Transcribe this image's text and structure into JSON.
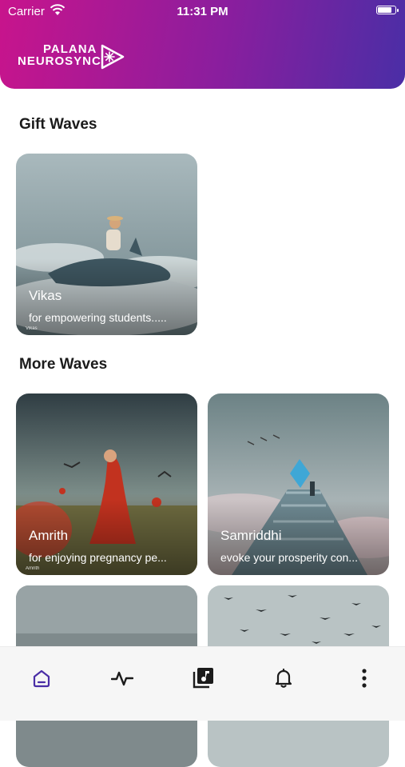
{
  "status_bar": {
    "carrier": "Carrier",
    "time": "11:31 PM",
    "battery_level": 0.9
  },
  "brand": {
    "line1": "PALANA",
    "line2": "NEUROSYNC"
  },
  "sections": {
    "gift_title": "Gift Waves",
    "more_title": "More Waves"
  },
  "gift_waves": [
    {
      "name": "Vikas",
      "description": "for empowering students.....",
      "caption": "Vikas"
    }
  ],
  "more_waves": [
    {
      "name": "Amrith",
      "description": "for enjoying pregnancy pe...",
      "caption": "Amrith"
    },
    {
      "name": "Samriddhi",
      "description": "evoke your prosperity con..."
    }
  ],
  "tabs": [
    {
      "icon": "home-icon",
      "active": true
    },
    {
      "icon": "activity-icon"
    },
    {
      "icon": "music-library-icon"
    },
    {
      "icon": "bell-icon"
    },
    {
      "icon": "more-vertical-icon"
    }
  ],
  "colors": {
    "header_start": "#c8148c",
    "header_end": "#4a2ea6",
    "active_tab": "#4a2ea6",
    "tab_icon": "#1b1b1b"
  }
}
